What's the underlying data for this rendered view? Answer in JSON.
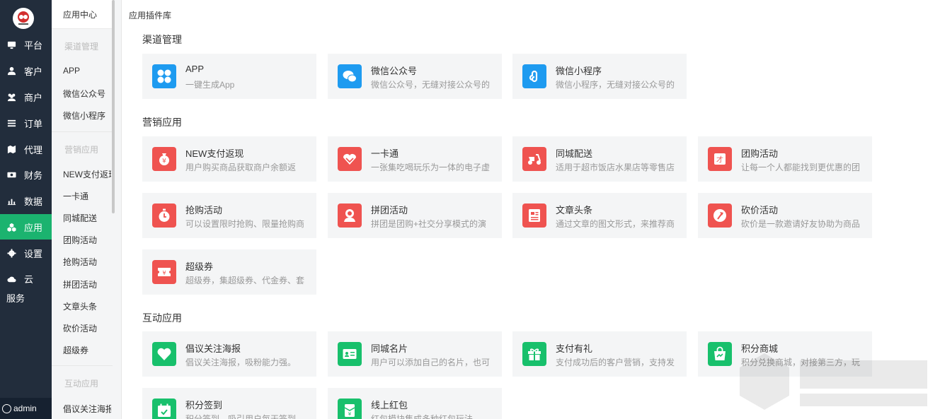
{
  "nav": {
    "items": [
      {
        "label": "平台",
        "icon": "monitor-icon"
      },
      {
        "label": "客户",
        "icon": "user-icon"
      },
      {
        "label": "商户",
        "icon": "users-icon"
      },
      {
        "label": "订单",
        "icon": "list-icon"
      },
      {
        "label": "代理",
        "icon": "map-icon"
      },
      {
        "label": "财务",
        "icon": "money-icon"
      },
      {
        "label": "数据",
        "icon": "bar-chart-icon"
      },
      {
        "label": "应用",
        "icon": "cubes-icon",
        "active": true
      },
      {
        "label": "设置",
        "icon": "gear-icon"
      },
      {
        "label": "云服务",
        "icon": "cloud-icon"
      }
    ],
    "user": "admin"
  },
  "subnav": {
    "header": "应用中心",
    "groups": [
      {
        "title": "渠道管理",
        "items": [
          "APP",
          "微信公众号",
          "微信小程序"
        ]
      },
      {
        "title": "营销应用",
        "items": [
          "NEW支付返现",
          "一卡通",
          "同城配送",
          "团购活动",
          "抢购活动",
          "拼团活动",
          "文章头条",
          "砍价活动",
          "超级券"
        ]
      },
      {
        "title": "互动应用",
        "items": [
          "倡议关注海报"
        ]
      }
    ]
  },
  "main": {
    "breadcrumb": "应用插件库",
    "sections": [
      {
        "title": "渠道管理",
        "cards": [
          {
            "title": "APP",
            "desc": "一键生成App",
            "color": "#1e9bf0",
            "icon": "app-grid-icon"
          },
          {
            "title": "微信公众号",
            "desc": "微信公众号，无缝对接公众号的",
            "color": "#1e9bf0",
            "icon": "wechat-icon"
          },
          {
            "title": "微信小程序",
            "desc": "微信小程序，无缝对接公众号的",
            "color": "#1e9bf0",
            "icon": "mini-program-icon"
          }
        ]
      },
      {
        "title": "营销应用",
        "cards": [
          {
            "title": "NEW支付返现",
            "desc": "用户购买商品获取商户余额返",
            "color": "#ef5350",
            "icon": "money-bag-icon"
          },
          {
            "title": "一卡通",
            "desc": "一张集吃喝玩乐为一体的电子虚",
            "color": "#ef5350",
            "icon": "heart-card-icon"
          },
          {
            "title": "同城配送",
            "desc": "适用于超市饭店水果店等零售店",
            "color": "#ef5350",
            "icon": "scooter-icon"
          },
          {
            "title": "团购活动",
            "desc": "让每一个人都能找到更优惠的团",
            "color": "#ef5350",
            "icon": "group-tag-icon"
          },
          {
            "title": "抢购活动",
            "desc": "可以设置限时抢购、限量抢购商",
            "color": "#ef5350",
            "icon": "stopwatch-icon"
          },
          {
            "title": "拼团活动",
            "desc": "拼团是团购+社交分享模式的演",
            "color": "#ef5350",
            "icon": "people-icon"
          },
          {
            "title": "文章头条",
            "desc": "通过文章的图文形式，来推荐商",
            "color": "#ef5350",
            "icon": "article-icon"
          },
          {
            "title": "砍价活动",
            "desc": "砍价是一款邀请好友协助为商品",
            "color": "#ef5350",
            "icon": "axe-icon"
          },
          {
            "title": "超级券",
            "desc": "超级券，集超级券、代金券、套",
            "color": "#ef5350",
            "icon": "coupon-icon"
          }
        ]
      },
      {
        "title": "互动应用",
        "cards": [
          {
            "title": "倡议关注海报",
            "desc": "倡议关注海报，吸粉能力强。",
            "color": "#18c06c",
            "icon": "heart-icon"
          },
          {
            "title": "同城名片",
            "desc": "用户可以添加自己的名片，也可",
            "color": "#18c06c",
            "icon": "id-card-icon"
          },
          {
            "title": "支付有礼",
            "desc": "支付成功后的客户营销，支持发",
            "color": "#18c06c",
            "icon": "gift-icon"
          },
          {
            "title": "积分商城",
            "desc": "积分兑换商城，对接第三方，玩",
            "color": "#18c06c",
            "icon": "shopping-bag-icon"
          },
          {
            "title": "积分签到",
            "desc": "积分签到，吸引用户每天签到",
            "color": "#18c06c",
            "icon": "calendar-check-icon"
          },
          {
            "title": "线上红包",
            "desc": "红包模块集成多种红包玩法",
            "color": "#18c06c",
            "icon": "red-packet-icon"
          }
        ]
      }
    ]
  }
}
